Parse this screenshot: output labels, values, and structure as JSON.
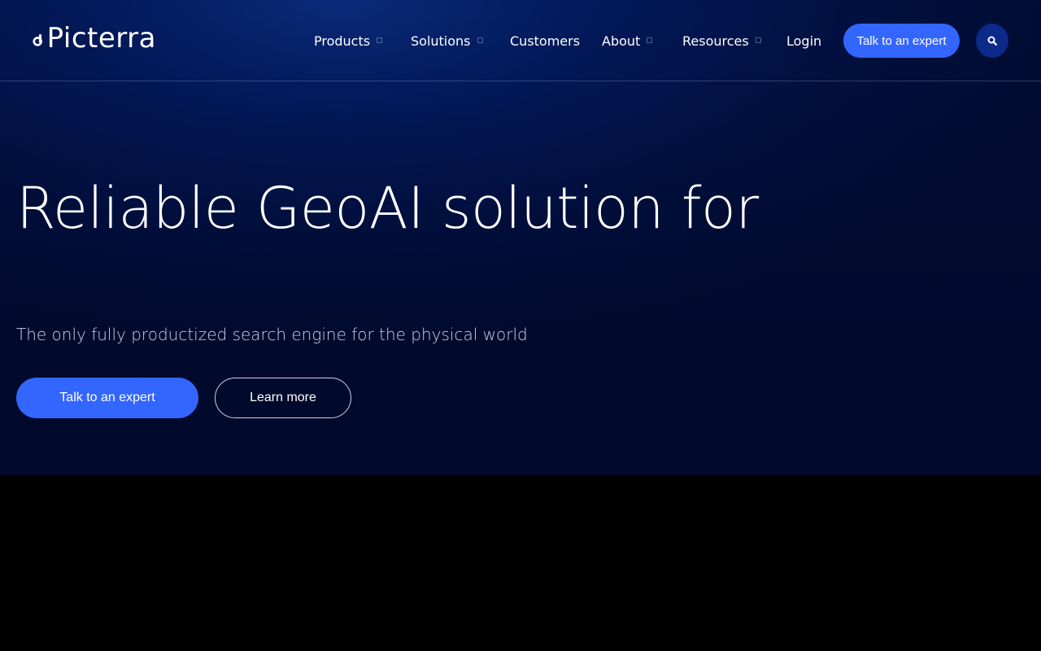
{
  "brand": {
    "name": "Picterra",
    "logo_text": "Picterra",
    "accent": "#3366ff",
    "hero_bg": "#011040"
  },
  "nav": {
    "items": [
      {
        "label": "Products",
        "has_dropdown": true
      },
      {
        "label": "Solutions",
        "has_dropdown": true
      },
      {
        "label": "Customers",
        "has_dropdown": false
      },
      {
        "label": "About",
        "has_dropdown": true
      },
      {
        "label": "Resources",
        "has_dropdown": true
      },
      {
        "label": "Login",
        "has_dropdown": false
      }
    ],
    "cta_label": "Talk to an expert",
    "search_icon": "search-icon"
  },
  "hero": {
    "headline": "Reliable GeoAI solution for",
    "subheadline": "The only fully productized search engine for the physical world",
    "primary_cta": "Talk to an expert",
    "secondary_cta": "Learn more"
  }
}
